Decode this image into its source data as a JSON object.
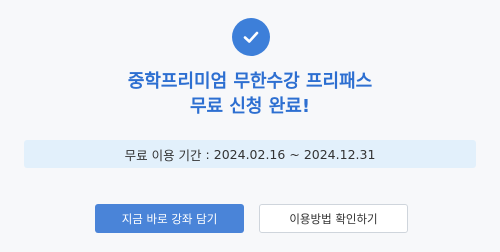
{
  "header": {
    "line1": "중학프리미엄 무한수강 프리패스",
    "line2": "무료 신청 완료!"
  },
  "period": {
    "label": "무료 이용 기간",
    "colon": ":",
    "start": "2024.02.16",
    "tilde": "~",
    "end": "2024.12.31"
  },
  "buttons": {
    "primary_label": "지금 바로 강좌 담기",
    "secondary_label": "이용방법 확인하기"
  },
  "colors": {
    "accent": "#3d7fd9",
    "headline": "#2d6fd1",
    "primary_button": "#4a84d8",
    "period_bg": "#e2f0fb"
  },
  "icons": {
    "status": "check-icon"
  }
}
